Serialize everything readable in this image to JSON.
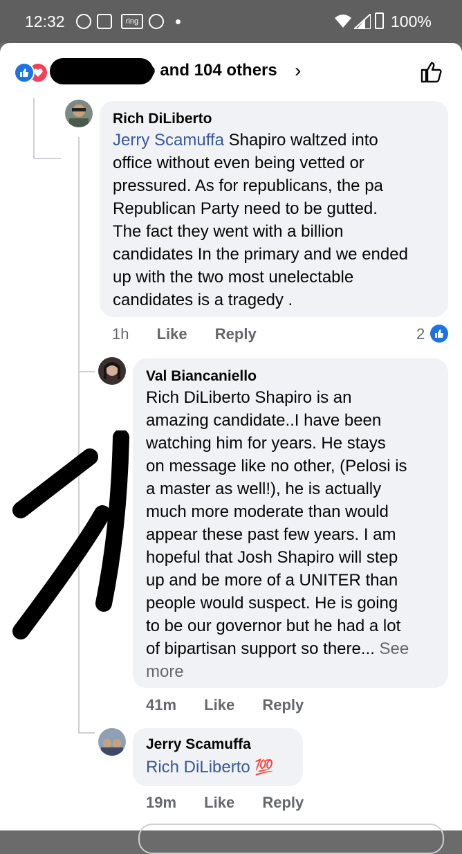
{
  "status_bar": {
    "time": "12:32",
    "notif_ring": "ring",
    "battery": "100%"
  },
  "reactions": {
    "summary_visible": "o and 104 others"
  },
  "comments": [
    {
      "author": "Rich DiLiberto",
      "mention": "Jerry Scamuffa",
      "text_lines": [
        " Shapiro waltzed into",
        "office without even being vetted or",
        "pressured.  As for republicans,  the pa",
        "Republican Party need to be gutted.",
        "The fact they went with a billion",
        "candidates In the primary and we ended",
        "up with the two most unelectable",
        "candidates is a tragedy ."
      ],
      "time": "1h",
      "like": "Like",
      "reply": "Reply",
      "like_count": "2"
    },
    {
      "author": "Val Biancaniello",
      "mention": "Rich DiLiberto",
      "text_lines": [
        " Shapiro is an",
        "amazing candidate..I have been",
        "watching him for years.  He stays",
        "on message like no other, (Pelosi is",
        "a master as well!), he is actually",
        "much more moderate than would",
        "appear these past few years.  I am",
        "hopeful that Josh Shapiro will step",
        "up and be more of a UNITER than",
        "people would suspect.  He is going",
        "to be our governor but he had a lot",
        "of bipartisan support so there... "
      ],
      "see_more": "See",
      "see_more_2": "more",
      "time": "41m",
      "like": "Like",
      "reply": "Reply"
    },
    {
      "author": "Jerry Scamuffa",
      "mention": "Rich DiLiberto",
      "emoji": "💯",
      "time": "19m",
      "like": "Like",
      "reply": "Reply"
    }
  ],
  "colors": {
    "accent": "#1b74e4",
    "mention": "#385898",
    "bubble": "#f0f2f5",
    "meta": "#65676b"
  }
}
